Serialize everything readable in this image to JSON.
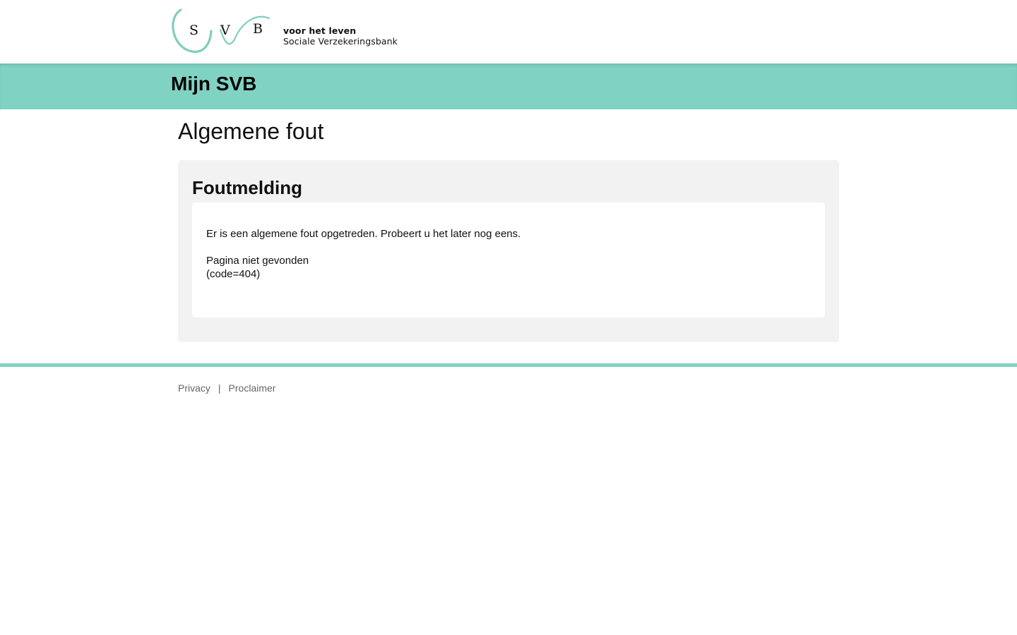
{
  "brand": {
    "logo_letters": [
      "S",
      "V",
      "B"
    ],
    "tagline": "voor het leven",
    "org_name": "Sociale Verzekeringsbank",
    "accent_color": "#80d2c3"
  },
  "app_bar": {
    "title": "Mijn SVB"
  },
  "main": {
    "page_title": "Algemene fout",
    "panel": {
      "title": "Foutmelding",
      "message": "Er is een algemene fout opgetreden. Probeert u het later nog eens.",
      "detail": "Pagina niet gevonden",
      "code": "(code=404)"
    }
  },
  "footer": {
    "links": [
      {
        "label": "Privacy"
      },
      {
        "label": "Proclaimer"
      }
    ],
    "separator": "|"
  }
}
